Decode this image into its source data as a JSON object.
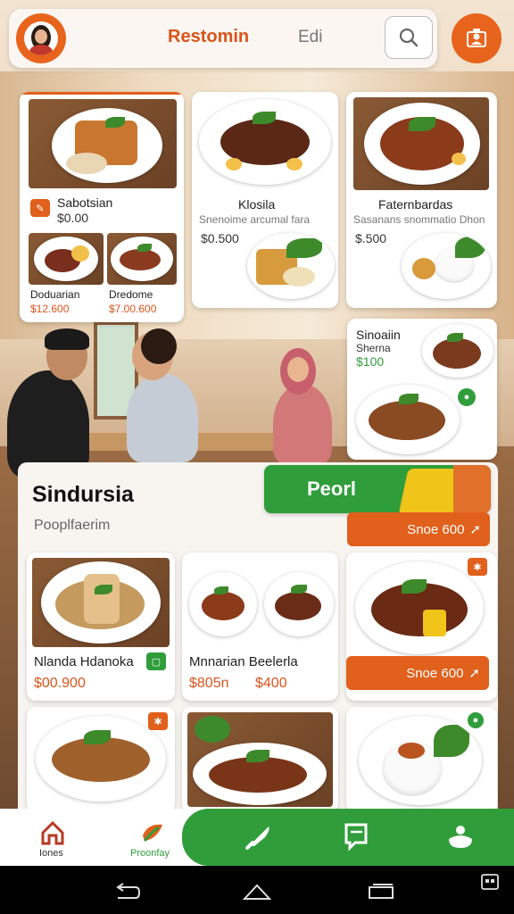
{
  "header": {
    "title": "Restomin",
    "alt_tab": "Edi",
    "icons": {
      "avatar": "user-avatar-icon",
      "search": "search-icon",
      "profile": "profile-icon"
    }
  },
  "featured": [
    {
      "title": "Sabotsian",
      "price": "$0.00",
      "subs": [
        {
          "title": "Doduarian",
          "price": "$12.600"
        },
        {
          "title": "Dredome",
          "price": "$7.00.600"
        }
      ]
    },
    {
      "title": "Klosila",
      "sub": "Snenoime arcumal fara",
      "price": "$0.500"
    },
    {
      "title": "Faternbardas",
      "sub": "Sasanans snommatio Dhon",
      "price": "$.500"
    },
    {
      "title": "Sinoaiin",
      "sub": "Sherna",
      "price": "$100"
    }
  ],
  "brand": {
    "title": "Sindursia",
    "subtitle": "Pooplfaerim"
  },
  "order_button": {
    "label": "Peorl"
  },
  "price_buttons": [
    "Snoe 600",
    "Snoe 600"
  ],
  "grid": [
    {
      "title": "Nlanda Hdanoka",
      "price": "$00.900"
    },
    {
      "title": "Mnnarian Beelerla",
      "price": "$805n",
      "price2": "$400"
    }
  ],
  "nav": [
    {
      "label": "Iones",
      "icon": "home-icon"
    },
    {
      "label": "Proonfay",
      "icon": "leaf-icon"
    },
    {
      "label": "",
      "icon": "chef-knife-icon"
    },
    {
      "label": "",
      "icon": "menu-book-icon"
    },
    {
      "label": "",
      "icon": "dish-icon"
    }
  ],
  "colors": {
    "accent": "#e0601c",
    "green": "#2f9e3a"
  }
}
